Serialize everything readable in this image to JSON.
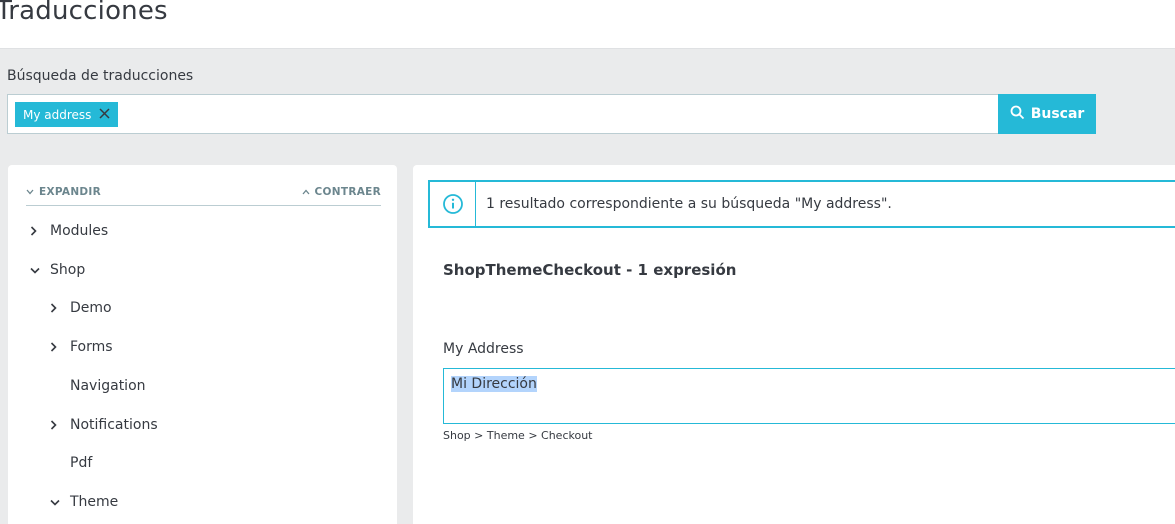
{
  "page": {
    "title": "Traducciones"
  },
  "search": {
    "label": "Búsqueda de traducciones",
    "tag": "My address",
    "button_label": "Buscar"
  },
  "tree": {
    "expand_label": "EXPANDIR",
    "collapse_label": "CONTRAER",
    "items": [
      {
        "label": "Modules",
        "chevron": "right"
      },
      {
        "label": "Shop",
        "chevron": "down"
      },
      {
        "label": "Demo",
        "chevron": "right"
      },
      {
        "label": "Forms",
        "chevron": "right"
      },
      {
        "label": "Navigation",
        "chevron": "none"
      },
      {
        "label": "Notifications",
        "chevron": "right"
      },
      {
        "label": "Pdf",
        "chevron": "none"
      },
      {
        "label": "Theme",
        "chevron": "down"
      }
    ]
  },
  "results": {
    "alert_text": "1 resultado correspondiente a su búsqueda \"My address\".",
    "domain_title": "ShopThemeCheckout - 1 expresión",
    "expression_label": "My Address",
    "translation_value": "Mi Dirección",
    "breadcrumb": "Shop > Theme > Checkout"
  },
  "colors": {
    "accent": "#25b9d7",
    "text": "#363a41",
    "muted": "#6c868e",
    "background": "#eaebec"
  }
}
